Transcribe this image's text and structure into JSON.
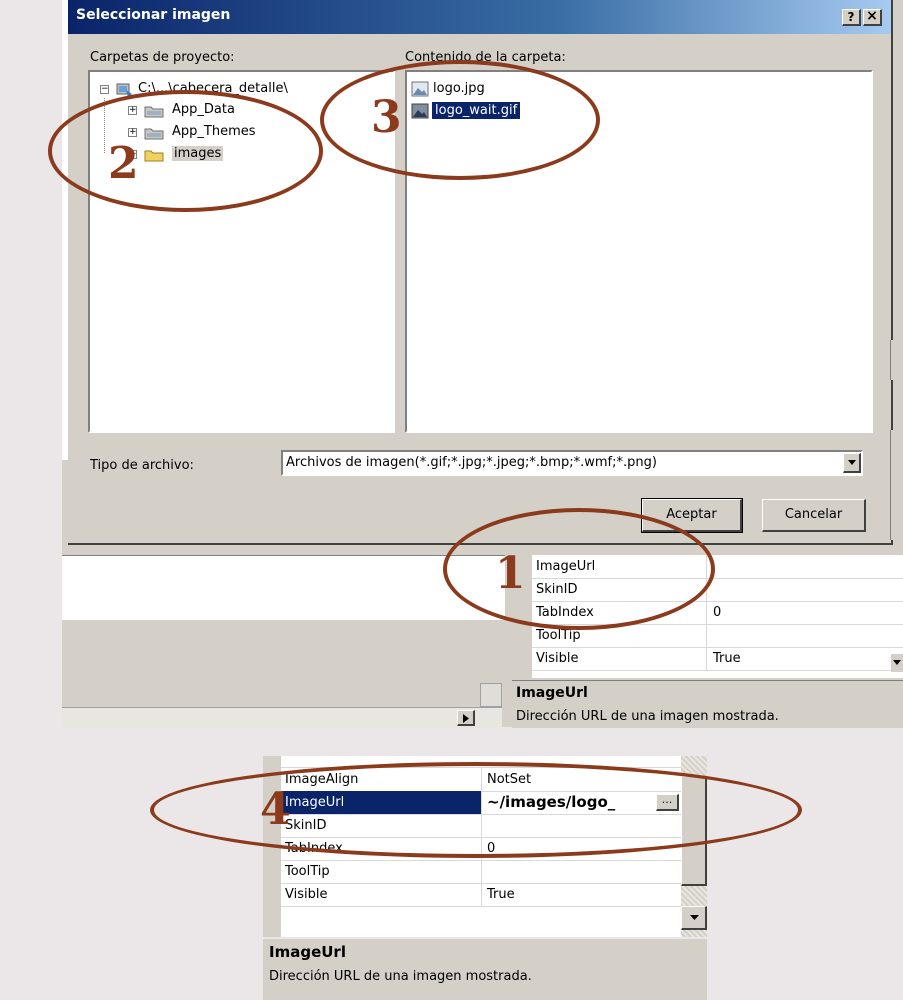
{
  "dialog": {
    "title": "Seleccionar imagen",
    "help_btn": "?",
    "close_btn": "×",
    "folders_label": "Carpetas de proyecto:",
    "contents_label": "Contenido de la carpeta:",
    "tree": {
      "root": "C:\\...\\cabecera_detalle\\",
      "children": [
        "App_Data",
        "App_Themes",
        "images"
      ]
    },
    "files": [
      "logo.jpg",
      "logo_wait.gif"
    ],
    "filetype_label": "Tipo de archivo:",
    "filetype_value": "Archivos de imagen(*.gif;*.jpg;*.jpeg;*.bmp;*.wmf;*.png)",
    "ok": "Aceptar",
    "cancel": "Cancelar"
  },
  "props_top": {
    "rows": [
      {
        "name": "ImageUrl",
        "value": ""
      },
      {
        "name": "SkinID",
        "value": ""
      },
      {
        "name": "TabIndex",
        "value": "0"
      },
      {
        "name": "ToolTip",
        "value": ""
      },
      {
        "name": "Visible",
        "value": "True"
      }
    ],
    "desc_title": "ImageUrl",
    "desc_text": "Dirección URL de una imagen mostrada."
  },
  "props_bottom": {
    "rows": [
      {
        "name": "ImageAlign",
        "value": "NotSet"
      },
      {
        "name": "ImageUrl",
        "value": "~/images/logo_"
      },
      {
        "name": "SkinID",
        "value": ""
      },
      {
        "name": "TabIndex",
        "value": "0"
      },
      {
        "name": "ToolTip",
        "value": ""
      },
      {
        "name": "Visible",
        "value": "True"
      }
    ],
    "ellipsis_btn": "...",
    "desc_title": "ImageUrl",
    "desc_text": "Dirección URL de una imagen mostrada."
  },
  "annotations": [
    "1",
    "2",
    "3",
    "4"
  ],
  "colors": {
    "title_bar": "#0a246a",
    "selection": "#0a246a",
    "annotation": "#8b3a1c",
    "dialog_bg": "#d4d0c8"
  }
}
